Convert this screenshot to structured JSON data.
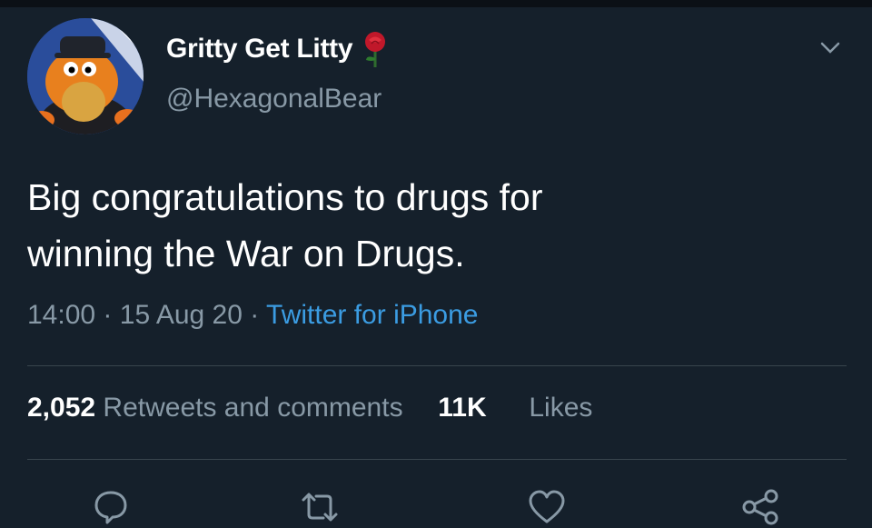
{
  "tweet": {
    "display_name": "Gritty Get Litty",
    "name_emoji_icon": "rose-icon",
    "handle": "@HexagonalBear",
    "text_line1": "Big congratulations to drugs for",
    "text_line2": "winning the War on Drugs.",
    "time": "14:00",
    "date": "15 Aug 20",
    "source": "Twitter for iPhone",
    "sep": "·"
  },
  "stats": {
    "retweets_count": "2,052",
    "retweets_label": "Retweets and comments",
    "likes_count": "11K",
    "likes_label": "Likes"
  },
  "actions": [
    "reply-icon",
    "retweet-icon",
    "like-icon",
    "share-icon"
  ],
  "colors": {
    "background": "#15202b",
    "text": "#ffffff",
    "secondary": "#8899a6",
    "link": "#3b9ce2",
    "divider": "#38444d"
  }
}
